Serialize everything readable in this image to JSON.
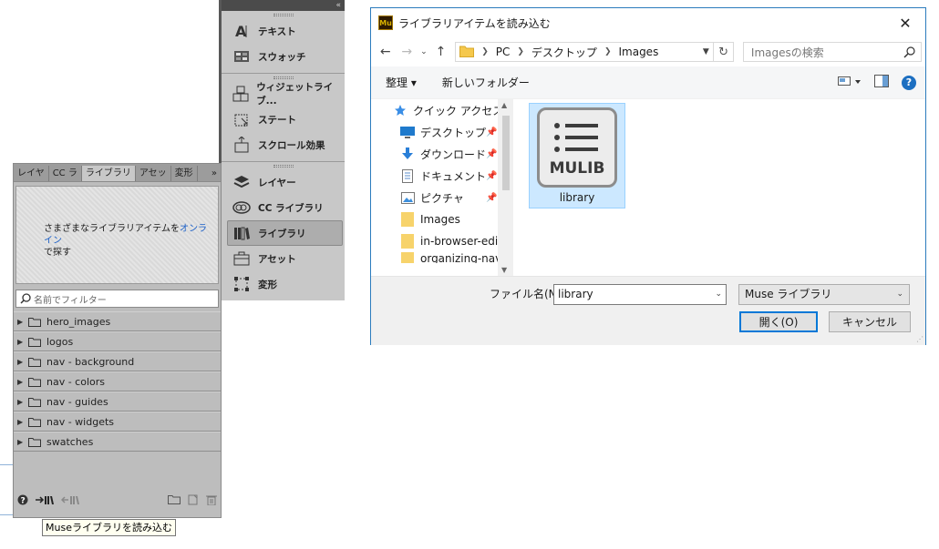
{
  "strip_panel": {
    "collapse_glyph": "«",
    "groups": [
      [
        {
          "label": "テキスト",
          "icon": "text-icon"
        },
        {
          "label": "スウォッチ",
          "icon": "swatches-icon"
        }
      ],
      [
        {
          "label": "ウィジェットライブ...",
          "icon": "widget-library-icon"
        },
        {
          "label": "ステート",
          "icon": "states-icon"
        },
        {
          "label": "スクロール効果",
          "icon": "scroll-effects-icon"
        }
      ],
      [
        {
          "label": "レイヤー",
          "icon": "layers-icon"
        },
        {
          "label": "CC ライブラリ",
          "icon": "cc-libraries-icon"
        },
        {
          "label": "ライブラリ",
          "icon": "library-icon",
          "active": true
        },
        {
          "label": "アセット",
          "icon": "assets-icon"
        },
        {
          "label": "変形",
          "icon": "transform-icon"
        }
      ]
    ]
  },
  "library_panel": {
    "tabs": [
      "レイヤ",
      "CC ラ",
      "ライブラリ",
      "アセッ",
      "変形"
    ],
    "tabs_more": "»",
    "info_text": "さまざまなライブラリアイテムを",
    "info_link": "オンライン",
    "info_text2": "で探す",
    "filter_placeholder": "名前でフィルター",
    "folders": [
      "hero_images",
      "logos",
      "nav - background",
      "nav - colors",
      "nav - guides",
      "nav - widgets",
      "swatches"
    ],
    "tooltip": "Museライブラリを読み込む"
  },
  "dialog": {
    "title": "ライブラリアイテムを読み込む",
    "app_badge": "Mu",
    "breadcrumb": [
      "PC",
      "デスクトップ",
      "Images"
    ],
    "search_placeholder": "Imagesの検索",
    "toolbar": {
      "organize": "整理 ▾",
      "new_folder": "新しいフォルダー"
    },
    "nav_items": [
      {
        "label": "クイック アクセス",
        "icon": "quick-access-icon",
        "pinned": false
      },
      {
        "label": "デスクトップ",
        "icon": "desktop-icon",
        "pinned": true
      },
      {
        "label": "ダウンロード",
        "icon": "download-icon",
        "pinned": true
      },
      {
        "label": "ドキュメント",
        "icon": "documents-icon",
        "pinned": true
      },
      {
        "label": "ピクチャ",
        "icon": "pictures-icon",
        "pinned": true
      },
      {
        "label": "Images",
        "icon": "folder-icon",
        "pinned": false
      },
      {
        "label": "in-browser-editi",
        "icon": "folder-icon",
        "pinned": false
      },
      {
        "label": "organizing-navi",
        "icon": "folder-icon",
        "pinned": false
      }
    ],
    "file": {
      "name": "library",
      "icon_text": "MULIB"
    },
    "filename_label": "ファイル名(N):",
    "filename_value": "library",
    "filetype": "Muse ライブラリ",
    "open_button": "開く(O)",
    "cancel_button": "キャンセル"
  }
}
